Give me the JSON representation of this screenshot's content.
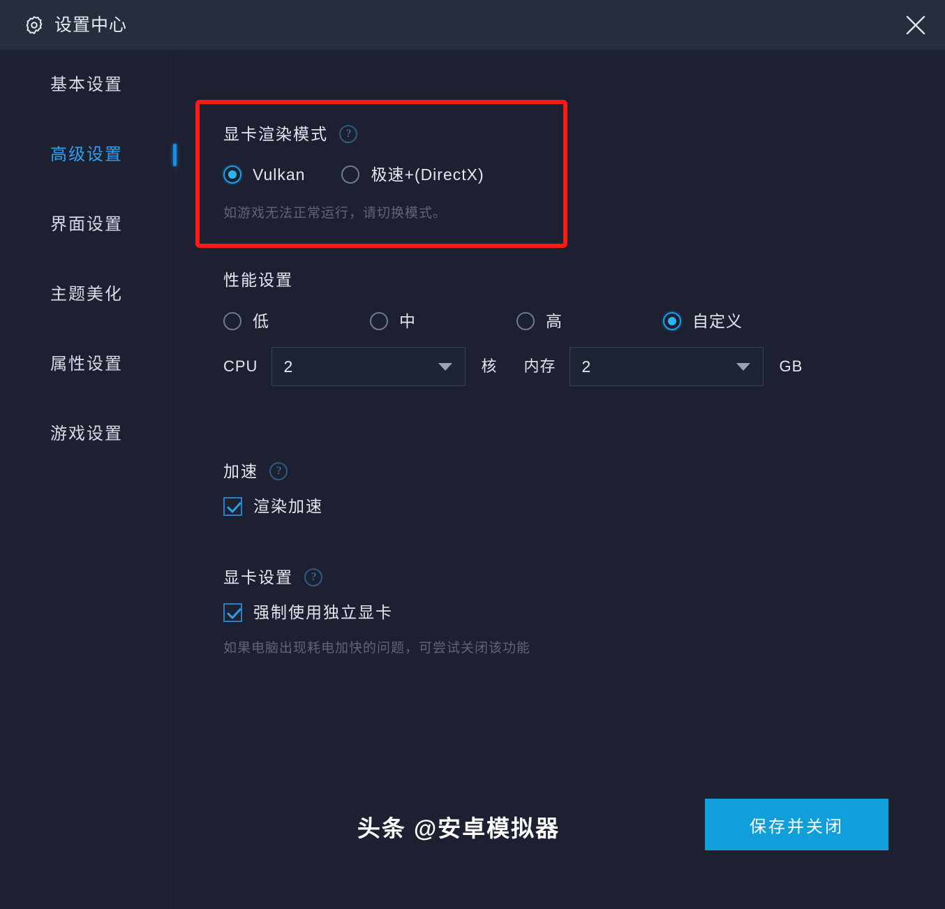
{
  "window": {
    "title": "设置中心",
    "gear_icon": "gear-icon",
    "close_icon": "close-icon"
  },
  "sidebar": {
    "items": [
      {
        "label": "基本设置",
        "active": false
      },
      {
        "label": "高级设置",
        "active": true
      },
      {
        "label": "界面设置",
        "active": false
      },
      {
        "label": "主题美化",
        "active": false
      },
      {
        "label": "属性设置",
        "active": false
      },
      {
        "label": "游戏设置",
        "active": false
      }
    ]
  },
  "render_mode": {
    "title": "显卡渲染模式",
    "help_icon": "help-icon",
    "options": [
      {
        "label": "Vulkan",
        "checked": true
      },
      {
        "label": "极速+(DirectX)",
        "checked": false
      }
    ],
    "hint": "如游戏无法正常运行，请切换模式。",
    "highlight_color": "#fb1b12"
  },
  "performance": {
    "title": "性能设置",
    "options": [
      {
        "label": "低",
        "checked": false
      },
      {
        "label": "中",
        "checked": false
      },
      {
        "label": "高",
        "checked": false
      },
      {
        "label": "自定义",
        "checked": true
      }
    ],
    "cpu": {
      "label": "CPU",
      "value": "2",
      "unit": "核"
    },
    "memory": {
      "label": "内存",
      "value": "2",
      "unit": "GB"
    }
  },
  "acceleration": {
    "title": "加速",
    "help_icon": "help-icon",
    "checkbox": {
      "label": "渲染加速",
      "checked": true
    }
  },
  "graphics": {
    "title": "显卡设置",
    "help_icon": "help-icon",
    "checkbox": {
      "label": "强制使用独立显卡",
      "checked": true
    },
    "hint": "如果电脑出现耗电加快的问题，可尝试关闭该功能"
  },
  "footer": {
    "save_label": "保存并关闭",
    "accent_color": "#109fdb",
    "watermark": "头条 @安卓模拟器"
  }
}
